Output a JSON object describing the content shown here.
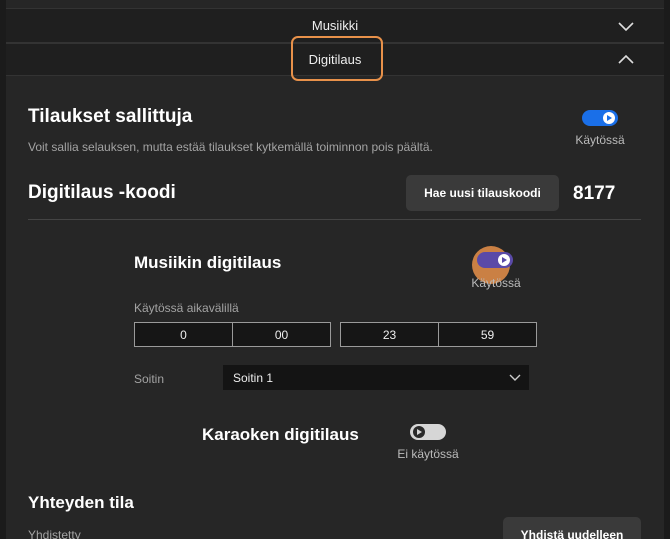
{
  "accordion": {
    "music_label": "Musiikki",
    "order_label": "Digitilaus"
  },
  "orders_allowed": {
    "title": "Tilaukset sallittuja",
    "description": "Voit sallia selauksen, mutta estää tilaukset kytkemällä toiminnon pois päältä.",
    "toggle_state": "Käytössä"
  },
  "order_code": {
    "title": "Digitilaus -koodi",
    "button_label": "Hae uusi tilauskoodi",
    "code": "8177"
  },
  "music_order": {
    "title": "Musiikin digitilaus",
    "toggle_state": "Käytössä",
    "interval_label": "Käytössä aikavälillä",
    "start_hour": "0",
    "start_minute": "00",
    "end_hour": "23",
    "end_minute": "59",
    "player_label": "Soitin",
    "player_value": "Soitin 1"
  },
  "karaoke_order": {
    "title": "Karaoken digitilaus",
    "toggle_state": "Ei käytössä"
  },
  "connection": {
    "title": "Yhteyden tila",
    "status": "Yhdistetty",
    "reconnect_label": "Yhdistä uudelleen"
  },
  "colors": {
    "accent": "#1a6fe8",
    "highlight": "#e8914a",
    "background": "#262626"
  }
}
